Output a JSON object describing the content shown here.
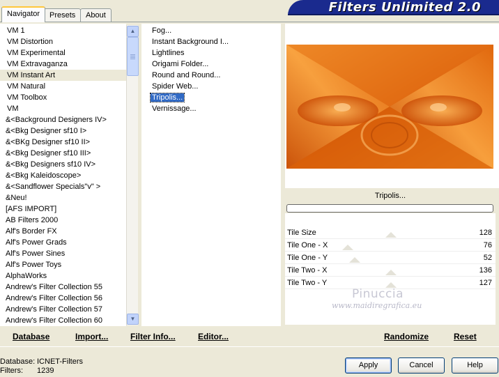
{
  "header": {
    "title": "Filters Unlimited 2.0"
  },
  "tabs": [
    {
      "label": "Navigator",
      "active": true
    },
    {
      "label": "Presets",
      "active": false
    },
    {
      "label": "About",
      "active": false
    }
  ],
  "categories": [
    "VM 1",
    "VM Distortion",
    "VM Experimental",
    "VM Extravaganza",
    "VM Instant Art",
    "VM Natural",
    "VM Toolbox",
    "VM",
    "&<Background Designers IV>",
    "&<Bkg Designer sf10 I>",
    "&<BKg Designer sf10 II>",
    "&<Bkg Designer sf10 III>",
    "&<Bkg Designers sf10 IV>",
    "&<Bkg Kaleidoscope>",
    "&<Sandflower Specials\"v\" >",
    "&Neu!",
    "[AFS IMPORT]",
    "AB Filters 2000",
    "Alf's Border FX",
    "Alf's Power Grads",
    "Alf's Power Sines",
    "Alf's Power Toys",
    "AlphaWorks",
    "Andrew's Filter Collection 55",
    "Andrew's Filter Collection 56",
    "Andrew's Filter Collection 57",
    "Andrew's Filter Collection 60"
  ],
  "selected_category_index": 4,
  "filters": [
    "Fog...",
    "Instant Background I...",
    "Lightlines",
    "Origami Folder...",
    "Round and Round...",
    "Spider Web...",
    "Tripolis...",
    "Vernissage..."
  ],
  "selected_filter_index": 6,
  "current_filter": "Tripolis...",
  "params": [
    {
      "label": "Tile Size",
      "value": "128"
    },
    {
      "label": "Tile One - X",
      "value": "76"
    },
    {
      "label": "Tile One - Y",
      "value": "52"
    },
    {
      "label": "Tile Two - X",
      "value": "136"
    },
    {
      "label": "Tile Two - Y",
      "value": "127"
    }
  ],
  "watermark": {
    "name": "Pinuccia",
    "site": "www.maidiregrafica.eu"
  },
  "links": {
    "database": "Database",
    "import": "Import...",
    "filter_info": "Filter Info...",
    "editor": "Editor...",
    "randomize": "Randomize",
    "reset": "Reset"
  },
  "status": {
    "database_label": "Database:",
    "database_value": "ICNET-Filters",
    "filters_label": "Filters:",
    "filters_value": "1239"
  },
  "buttons": {
    "apply": "Apply",
    "cancel": "Cancel",
    "help": "Help"
  },
  "icons": {
    "scroll_up": "scroll-up-arrow-icon",
    "scroll_down": "scroll-down-arrow-icon"
  },
  "colors": {
    "selection": "#316ac5",
    "banner": "#1a2a8e",
    "preview_orange": "#d4620a"
  }
}
